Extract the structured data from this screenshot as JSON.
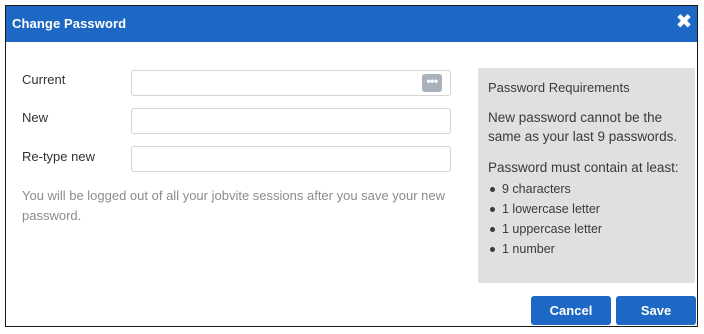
{
  "dialog": {
    "title": "Change Password",
    "close_glyph": "✖"
  },
  "form": {
    "current_label": "Current",
    "new_label": "New",
    "retype_label": "Re-type new",
    "current_value": "",
    "new_value": "",
    "retype_value": "",
    "note": "You will be logged out of all your jobvite sessions after you save your new password."
  },
  "requirements": {
    "title": "Password Requirements",
    "history_rule": "New password cannot be the same as your last 9 passwords.",
    "contain_intro": "Password must contain at least:",
    "items": [
      "9 characters",
      "1 lowercase letter",
      "1 uppercase letter",
      "1 number"
    ]
  },
  "buttons": {
    "cancel": "Cancel",
    "save": "Save"
  },
  "icons": {
    "close": "close-icon",
    "password_manager": "password-manager-icon",
    "password_manager_glyph": "•••"
  },
  "colors": {
    "primary": "#1d68c4",
    "panel_bg": "#e0e0e0"
  }
}
